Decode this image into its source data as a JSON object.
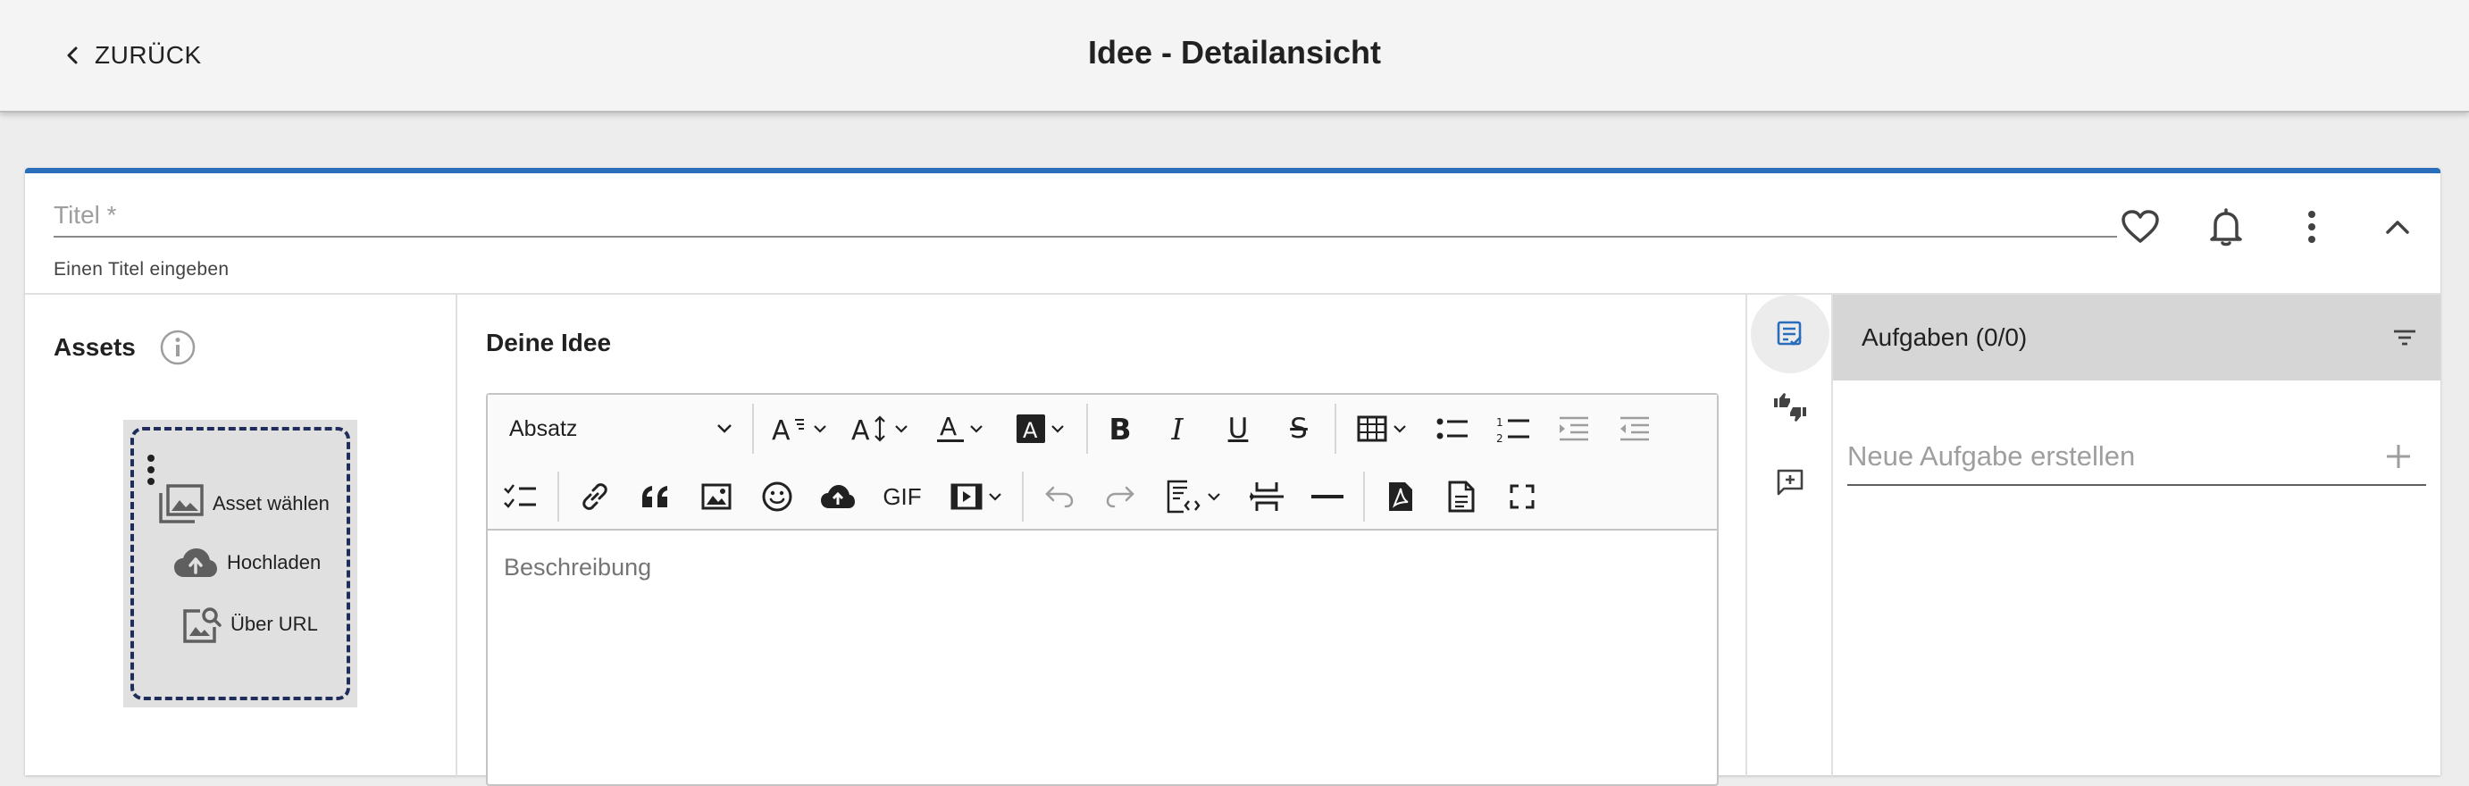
{
  "header": {
    "back_label": "ZURÜCK",
    "title": "Idee - Detailansicht"
  },
  "title_field": {
    "placeholder": "Titel *",
    "hint": "Einen Titel eingeben"
  },
  "title_actions": [
    "heart-icon",
    "bell-icon",
    "more-vertical-icon",
    "chevron-up-icon"
  ],
  "assets": {
    "title": "Assets",
    "options": [
      {
        "label": "Asset wählen",
        "icon": "photo-library-icon"
      },
      {
        "label": "Hochladen",
        "icon": "cloud-upload-icon"
      },
      {
        "label": "Über URL",
        "icon": "image-search-icon"
      }
    ]
  },
  "idea": {
    "title": "Deine Idee",
    "paragraph_select": "Absatz",
    "gif_label": "GIF",
    "description_placeholder": "Beschreibung"
  },
  "tasks": {
    "title": "Aufgaben (0/0)",
    "new_task_placeholder": "Neue Aufgabe erstellen"
  },
  "colors": {
    "accent": "#2a6ebb",
    "header_bg": "#f4f4f4",
    "tasks_header_bg": "#d6d6d6",
    "dropzone_border": "#1f2d5a"
  }
}
